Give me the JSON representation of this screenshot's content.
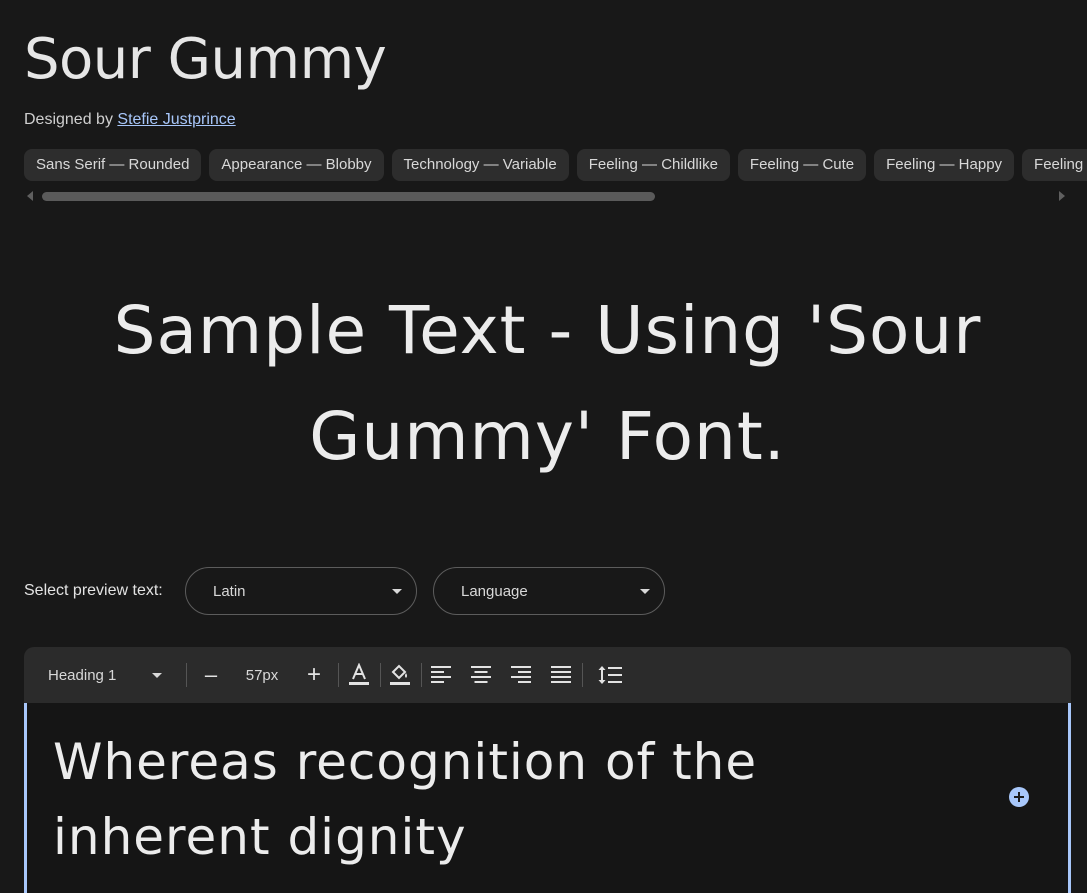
{
  "font": {
    "name": "Sour Gummy",
    "designed_by_prefix": "Designed by",
    "designer": "Stefie Justprince"
  },
  "tags": [
    "Sans Serif — Rounded",
    "Appearance — Blobby",
    "Technology — Variable",
    "Feeling — Childlike",
    "Feeling — Cute",
    "Feeling — Happy",
    "Feeling — Playful"
  ],
  "sample_text": "Sample Text - Using 'Sour Gummy' Font.",
  "preview": {
    "label": "Select preview text:",
    "script_value": "Latin",
    "language_value": "Language"
  },
  "toolbar": {
    "style_value": "Heading 1",
    "size_value": "57px",
    "decrease_label": "–",
    "increase_label": "+"
  },
  "editor": {
    "text": "Whereas recognition of the inherent dignity"
  },
  "colors": {
    "background": "#181818",
    "link": "#a8c7fa",
    "accent": "#a8c7fa",
    "chip": "#2d2d2d"
  }
}
